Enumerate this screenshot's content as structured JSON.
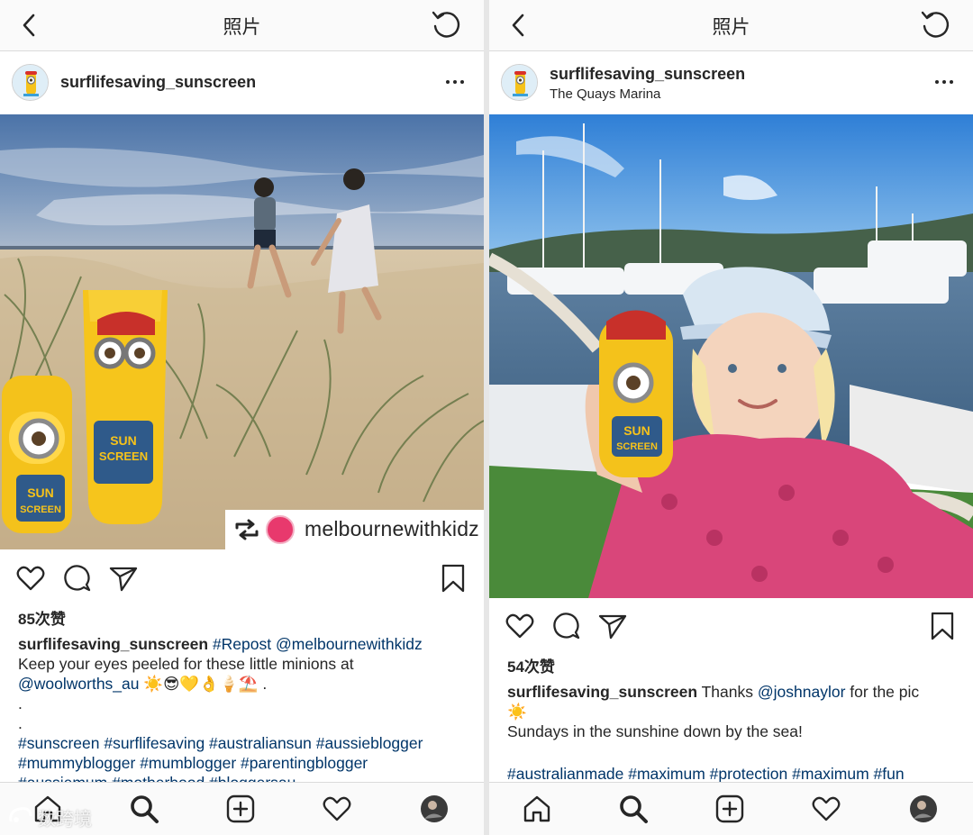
{
  "left": {
    "header_title": "照片",
    "username": "surflifesaving_sunscreen",
    "repost_username": "melbournewithkidz",
    "likes": "85次赞",
    "caption_user": "surflifesaving_sunscreen",
    "caption_tag1": "#Repost",
    "caption_mention1": "@melbournewithkidz",
    "caption_line2": "Keep your eyes peeled for these little minions at",
    "caption_mention2": "@woolworths_au",
    "caption_emojis": "☀️😎💛👌🍦⛱️ .",
    "dot1": ".",
    "dot2": ".",
    "hashtags1": "#sunscreen #surflifesaving #australiansun  #aussieblogger",
    "hashtags2": "#mummyblogger #mumblogger #parentingblogger",
    "hashtags3": "#aussiemum #motherhood #bloggersau"
  },
  "right": {
    "header_title": "照片",
    "username": "surflifesaving_sunscreen",
    "location": "The Quays Marina",
    "likes": "54次赞",
    "caption_user": "surflifesaving_sunscreen",
    "caption_text1": "Thanks",
    "caption_mention": "@joshnaylor",
    "caption_text2": "for the pic",
    "caption_emoji": "☀️",
    "caption_line2": "Sundays in the sunshine down by the sea!",
    "hashtags": "#australianmade #maximum #protection #maximum #fun"
  },
  "watermark": "数跨境",
  "colors": {
    "link": "#003569",
    "text": "#262626",
    "bar_bg": "#fafafa",
    "divider": "#dbdbdb"
  },
  "icons": [
    "back-chevron-icon",
    "refresh-icon",
    "more-icon",
    "heart-icon",
    "comment-icon",
    "share-icon",
    "bookmark-icon",
    "home-icon",
    "search-icon",
    "add-icon",
    "activity-icon",
    "profile-icon",
    "repost-icon"
  ]
}
